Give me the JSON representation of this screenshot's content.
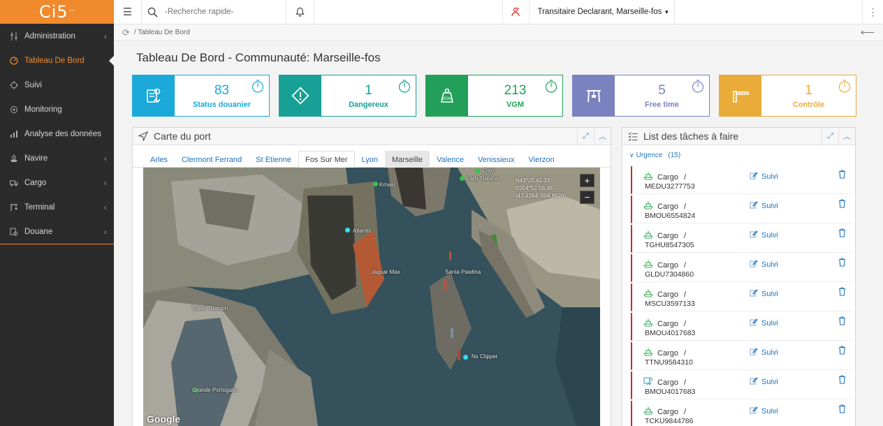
{
  "app": {
    "logo": "Ci5",
    "logo_sup": "°°°"
  },
  "sidebar": {
    "items": [
      {
        "label": "Administration",
        "icon": "sliders-icon",
        "chevron": true,
        "active": false
      },
      {
        "label": "Tableau De Bord",
        "icon": "dashboard-icon",
        "chevron": false,
        "active": true
      },
      {
        "label": "Suivi",
        "icon": "target-icon",
        "chevron": false,
        "active": false
      },
      {
        "label": "Monitoring",
        "icon": "monitor-icon",
        "chevron": false,
        "active": false
      },
      {
        "label": "Analyse des données",
        "icon": "chart-icon",
        "chevron": false,
        "active": false
      },
      {
        "label": "Navire",
        "icon": "ship-icon",
        "chevron": true,
        "active": false
      },
      {
        "label": "Cargo",
        "icon": "truck-icon",
        "chevron": true,
        "active": false
      },
      {
        "label": "Terminal",
        "icon": "crane-icon",
        "chevron": true,
        "active": false
      },
      {
        "label": "Douane",
        "icon": "customs-icon",
        "chevron": true,
        "active": false
      }
    ]
  },
  "topbar": {
    "search_placeholder": "-Recherche rapide-",
    "user": "Transitaire Declarant, Marseille-fos"
  },
  "breadcrumb": {
    "label": "/ Tableau De Bord"
  },
  "page": {
    "title": "Tableau De Bord - Communauté: Marseille-fos"
  },
  "kpis": [
    {
      "value": "83",
      "label": "Status douanier",
      "color": "#1aa9d9",
      "icon": "customs-doc-icon"
    },
    {
      "value": "1",
      "label": "Dangereux",
      "color": "#17a095",
      "icon": "warning-diamond-icon"
    },
    {
      "value": "213",
      "label": "VGM",
      "color": "#22a05a",
      "icon": "vgm-weight-icon"
    },
    {
      "value": "5",
      "label": "Free time",
      "color": "#7b82c0",
      "icon": "gantry-crane-icon"
    },
    {
      "value": "1",
      "label": "Contrôle",
      "color": "#e9ac38",
      "icon": "barrier-icon"
    }
  ],
  "map_panel": {
    "title": "Carte du port",
    "tabs": [
      "Arles",
      "Clermont Ferrand",
      "St Etienne",
      "Fos Sur Mer",
      "Lyon",
      "Marseille",
      "Valence",
      "Venissieux",
      "Vierzon"
    ],
    "active_tab": "Fos Sur Mer",
    "highlight_tab": "Marseille",
    "coords": [
      "N43°25.42.33",
      "E004°52.58.46",
      "(43.4284, 004.8829)"
    ],
    "vessels": [
      "Oslo",
      "Lady Nabiha",
      "Kmasi",
      "Atlantis",
      "Jaguar Max",
      "Santa Pawlina",
      "Taipei Triumph",
      "Ns Clipper",
      "Grande Portogallo"
    ],
    "logo": "Google",
    "zoom_in": "+",
    "zoom_out": "−"
  },
  "tasks_panel": {
    "title": "List des tâches à faire",
    "group_label": "Urgence",
    "group_count": "(15)",
    "cargo_label": "Cargo",
    "sep": "/",
    "suivi_label": "Suivi",
    "items": [
      {
        "code": "MEDU3277753",
        "icon": "cargo-ship-icon"
      },
      {
        "code": "BMOU6554824",
        "icon": "cargo-ship-icon"
      },
      {
        "code": "TGHU8547305",
        "icon": "cargo-ship-icon"
      },
      {
        "code": "GLDU7304860",
        "icon": "cargo-ship-icon"
      },
      {
        "code": "MSCU3597133",
        "icon": "cargo-ship-icon"
      },
      {
        "code": "BMOU4017683",
        "icon": "cargo-ship-icon"
      },
      {
        "code": "TTNU9584310",
        "icon": "cargo-ship-icon"
      },
      {
        "code": "BMOU4017683",
        "icon": "customs-cargo-icon"
      },
      {
        "code": "TCKU9844786",
        "icon": "cargo-ship-icon"
      }
    ]
  },
  "colors": {
    "accent": "#f08a2c",
    "sidebar": "#2b2b2b",
    "link": "#1e73be",
    "urgent": "#c9282d"
  }
}
